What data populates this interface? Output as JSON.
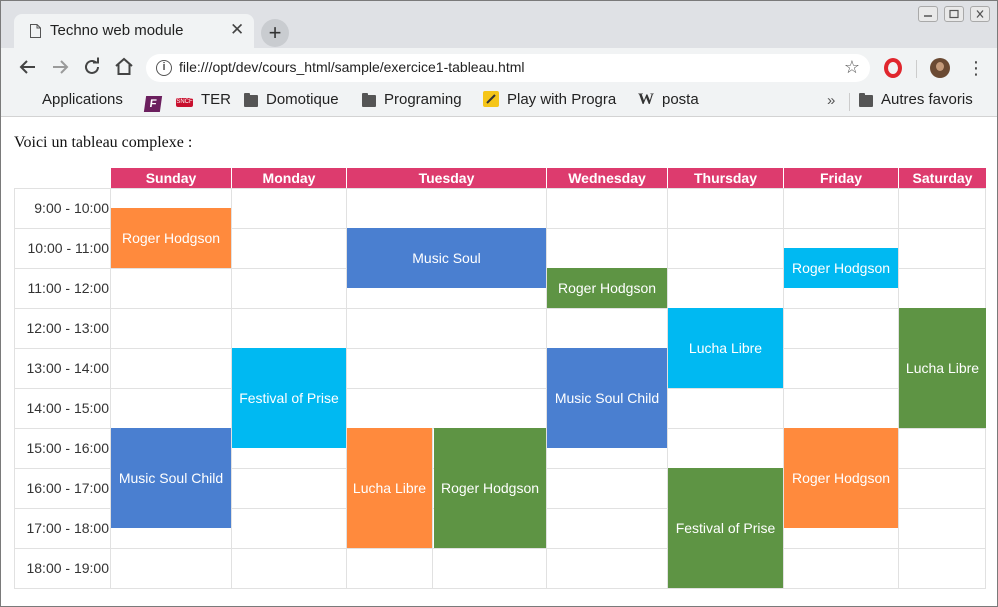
{
  "browser": {
    "tab_title": "Techno web module",
    "url": "file:///opt/dev/cours_html/sample/exercice1-tableau.html"
  },
  "bookmarks": [
    {
      "label": "Applications",
      "icon": "apps-grid-icon"
    },
    {
      "label": "",
      "icon": "f-logo-icon"
    },
    {
      "label": "TER",
      "icon": "sncf-icon"
    },
    {
      "label": "Domotique",
      "icon": "folder-icon"
    },
    {
      "label": "Programing",
      "icon": "folder-icon"
    },
    {
      "label": "Play with Progra",
      "icon": "play-icon"
    },
    {
      "label": "posta",
      "icon": "wikipedia-icon"
    },
    {
      "label": "Autres favoris",
      "icon": "folder-icon"
    }
  ],
  "page": {
    "intro": "Voici un tableau complexe :",
    "days": [
      "Sunday",
      "Monday",
      "Tuesday",
      "Wednesday",
      "Thursday",
      "Friday",
      "Saturday"
    ],
    "times": [
      "9:00 - 10:00",
      "10:00 - 11:00",
      "11:00 - 12:00",
      "12:00 - 13:00",
      "13:00 - 14:00",
      "14:00 - 15:00",
      "15:00 - 16:00",
      "16:00 - 17:00",
      "17:00 - 18:00",
      "18:00 - 19:00"
    ],
    "events": [
      {
        "title": "Roger Hodgson",
        "day": "Sunday",
        "start": "9:30",
        "end": "11:00",
        "color": "#ff8a3d"
      },
      {
        "title": "Music Soul Child",
        "day": "Sunday",
        "start": "15:00",
        "end": "17:30",
        "color": "#4a7fd0"
      },
      {
        "title": "Festival of Prise",
        "day": "Monday",
        "start": "13:00",
        "end": "15:30",
        "color": "#00b9f2"
      },
      {
        "title": "Music Soul",
        "day": "Tuesday",
        "start": "10:00",
        "end": "11:30",
        "color": "#4a7fd0"
      },
      {
        "title": "Lucha Libre",
        "day": "Tuesday",
        "start": "15:00",
        "end": "18:00",
        "color": "#ff8a3d"
      },
      {
        "title": "Roger Hodgson",
        "day": "Tuesday",
        "start": "15:00",
        "end": "18:00",
        "color": "#5e9444"
      },
      {
        "title": "Roger Hodgson",
        "day": "Wednesday",
        "start": "11:00",
        "end": "12:00",
        "color": "#5e9444"
      },
      {
        "title": "Music Soul Child",
        "day": "Wednesday",
        "start": "13:00",
        "end": "15:30",
        "color": "#4a7fd0"
      },
      {
        "title": "Lucha Libre",
        "day": "Thursday",
        "start": "12:00",
        "end": "14:00",
        "color": "#00b9f2"
      },
      {
        "title": "Festival of Prise",
        "day": "Thursday",
        "start": "16:00",
        "end": "19:00",
        "color": "#5e9444"
      },
      {
        "title": "Roger Hodgson",
        "day": "Friday",
        "start": "10:30",
        "end": "11:30",
        "color": "#00b9f2"
      },
      {
        "title": "Roger Hodgson",
        "day": "Friday",
        "start": "15:00",
        "end": "17:30",
        "color": "#ff8a3d"
      },
      {
        "title": "Lucha Libre",
        "day": "Saturday",
        "start": "12:00",
        "end": "15:00",
        "color": "#5e9444"
      }
    ],
    "header_color": "#dd3b6e"
  }
}
